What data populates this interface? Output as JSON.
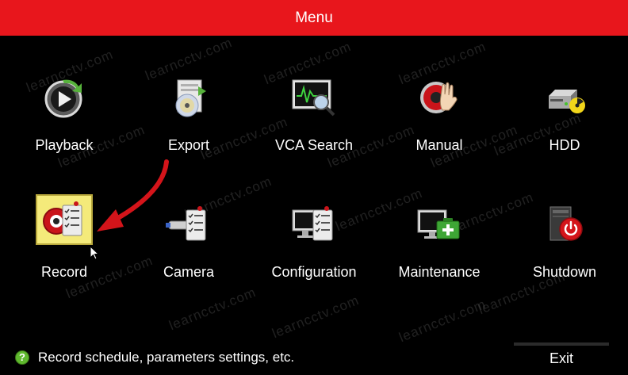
{
  "window": {
    "title": "Menu"
  },
  "menu": {
    "items": [
      {
        "label": "Playback",
        "icon": "playback-icon"
      },
      {
        "label": "Export",
        "icon": "export-icon"
      },
      {
        "label": "VCA Search",
        "icon": "vca-search-icon"
      },
      {
        "label": "Manual",
        "icon": "manual-icon"
      },
      {
        "label": "HDD",
        "icon": "hdd-icon"
      },
      {
        "label": "Record",
        "icon": "record-icon",
        "selected": true
      },
      {
        "label": "Camera",
        "icon": "camera-icon"
      },
      {
        "label": "Configuration",
        "icon": "configuration-icon"
      },
      {
        "label": "Maintenance",
        "icon": "maintenance-icon"
      },
      {
        "label": "Shutdown",
        "icon": "shutdown-icon"
      }
    ]
  },
  "status": {
    "icon": "help-icon",
    "text": "Record schedule, parameters settings, etc.",
    "exit_label": "Exit"
  },
  "watermark": {
    "text": "learncctv.com"
  },
  "colors": {
    "title_bar": "#e8161c",
    "background": "#000000",
    "selected_tile": "#f4ea7a",
    "arrow": "#d4141a"
  }
}
